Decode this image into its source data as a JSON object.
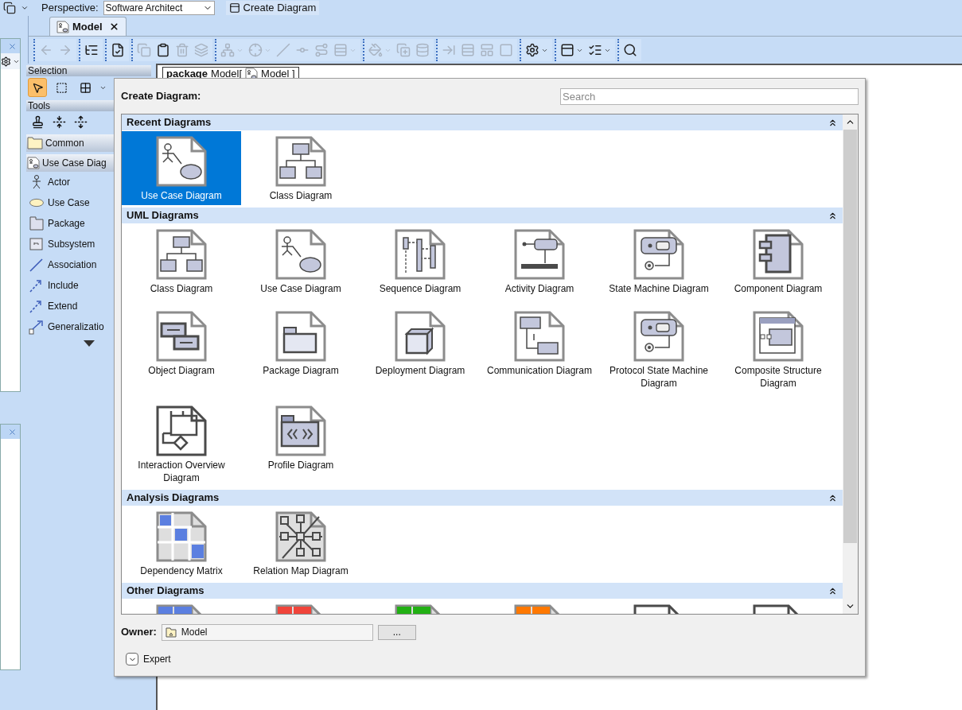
{
  "top_toolbar": {
    "perspective_label": "Perspective:",
    "perspective": "Software Architect",
    "create_button": "Create Diagram"
  },
  "tab": {
    "title": "Model",
    "selected": true
  },
  "editor_toolbar": [
    [
      {
        "kind": "back",
        "disabled": true
      },
      {
        "kind": "forward",
        "disabled": true
      }
    ],
    [
      {
        "kind": "tree",
        "disabled": false
      }
    ],
    [
      {
        "kind": "validate",
        "disabled": false
      }
    ],
    [
      {
        "kind": "copy",
        "disabled": true
      },
      {
        "kind": "paste",
        "disabled": false
      },
      {
        "kind": "delete",
        "disabled": true
      },
      {
        "kind": "delete-model",
        "disabled": true
      }
    ],
    [
      {
        "kind": "layout",
        "disabled": true
      },
      {
        "kind": "cross",
        "disabled": true
      },
      {
        "kind": "line",
        "disabled": true
      },
      {
        "kind": "path",
        "disabled": true
      },
      {
        "kind": "route",
        "disabled": true
      },
      {
        "kind": "align",
        "disabled": true
      }
    ],
    [
      {
        "kind": "paint",
        "disabled": true
      },
      {
        "kind": "copy-style",
        "disabled": true
      },
      {
        "kind": "database",
        "disabled": true
      }
    ],
    [
      {
        "kind": "move",
        "disabled": true
      },
      {
        "kind": "rows",
        "disabled": true
      },
      {
        "kind": "panel",
        "disabled": true
      },
      {
        "kind": "square",
        "disabled": true
      }
    ],
    [
      {
        "kind": "settings",
        "disabled": false
      }
    ],
    [
      {
        "kind": "panel-top",
        "disabled": false
      },
      {
        "kind": "list",
        "disabled": false
      }
    ],
    [
      {
        "kind": "search",
        "disabled": false
      }
    ]
  ],
  "palette": {
    "selection_title": "Selection",
    "selection_tools": [
      {
        "kind": "pointer",
        "selected": true
      },
      {
        "kind": "marquee",
        "selected": false
      },
      {
        "kind": "group",
        "selected": false
      }
    ],
    "tools_title": "Tools",
    "groups": [
      {
        "title": "Common",
        "kind": "folder"
      },
      {
        "title": "Use Case Diag",
        "kind": "diagram"
      }
    ],
    "items": [
      {
        "label": "Actor",
        "kind": "actor"
      },
      {
        "label": "Use Case",
        "kind": "usecase"
      },
      {
        "label": "Package",
        "kind": "package"
      },
      {
        "label": "Subsystem",
        "kind": "subsystem"
      },
      {
        "label": "Association",
        "kind": "association"
      },
      {
        "label": "Include",
        "kind": "include"
      },
      {
        "label": "Extend",
        "kind": "extend"
      },
      {
        "label": "Generalizatio",
        "kind": "generalization"
      }
    ]
  },
  "diagram_frame": {
    "keyword": "package",
    "name": "Model[",
    "element": "Model ]"
  },
  "dialog": {
    "title": "Create Diagram:",
    "search_placeholder": "Search",
    "sections": [
      {
        "title": "Recent Diagrams",
        "expanded": true,
        "items": [
          {
            "label": "Use Case Diagram",
            "kind": "usecase",
            "selected": true
          },
          {
            "label": "Class Diagram",
            "kind": "class",
            "selected": false
          }
        ]
      },
      {
        "title": "UML Diagrams",
        "expanded": true,
        "items": [
          {
            "label": "Class Diagram",
            "kind": "class",
            "selected": false
          },
          {
            "label": "Use Case Diagram",
            "kind": "usecase",
            "selected": false
          },
          {
            "label": "Sequence Diagram",
            "kind": "sequence",
            "selected": false
          },
          {
            "label": "Activity Diagram",
            "kind": "activity",
            "selected": false
          },
          {
            "label": "State Machine Diagram",
            "kind": "state",
            "selected": false
          },
          {
            "label": "Component Diagram",
            "kind": "component",
            "selected": false
          },
          {
            "label": "Object Diagram",
            "kind": "object",
            "selected": false
          },
          {
            "label": "Package Diagram",
            "kind": "package",
            "selected": false
          },
          {
            "label": "Deployment Diagram",
            "kind": "deployment",
            "selected": false
          },
          {
            "label": "Communication Diagram",
            "kind": "communication",
            "selected": false
          },
          {
            "label": "Protocol State Machine Diagram",
            "kind": "state",
            "selected": false
          },
          {
            "label": "Composite Structure Diagram",
            "kind": "composite",
            "selected": false
          },
          {
            "label": "Interaction Overview Diagram",
            "kind": "interaction",
            "selected": false
          },
          {
            "label": "Profile Diagram",
            "kind": "profile",
            "selected": false
          }
        ]
      },
      {
        "title": "Analysis Diagrams",
        "expanded": true,
        "items": [
          {
            "label": "Dependency Matrix",
            "kind": "matrix",
            "selected": false
          },
          {
            "label": "Relation Map Diagram",
            "kind": "relation",
            "selected": false
          }
        ]
      },
      {
        "title": "Other Diagrams",
        "expanded": true,
        "items": [
          {
            "kind": "table",
            "color": "#5b7fe0",
            "selected": false
          },
          {
            "kind": "table",
            "color": "#f0443a",
            "selected": false
          },
          {
            "kind": "table",
            "color": "#22b014",
            "selected": false
          },
          {
            "kind": "table",
            "color": "#ff7800",
            "selected": false
          },
          {
            "kind": "form",
            "selected": false
          },
          {
            "kind": "text",
            "selected": false
          }
        ]
      }
    ],
    "owner_label": "Owner:",
    "owner": "Model",
    "browse_button": "...",
    "expert": {
      "label": "Expert",
      "expanded": false
    }
  }
}
